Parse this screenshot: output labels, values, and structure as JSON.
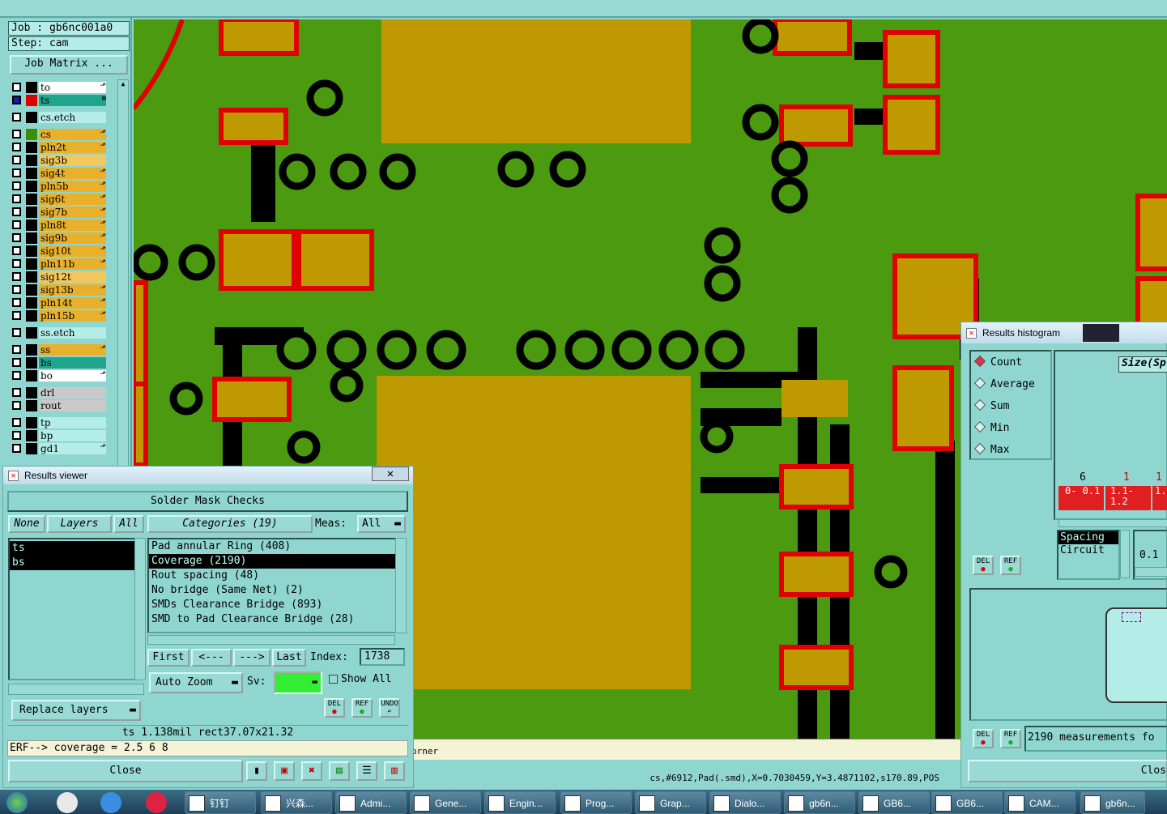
{
  "job": {
    "job_label": "Job : gb6nc001a0",
    "step_label": "Step: cam",
    "matrix_button": "Job Matrix ..."
  },
  "layers": [
    {
      "name": "to",
      "color": "#ffffff",
      "mark": "⬏"
    },
    {
      "name": "ts",
      "color": "#1fa58e",
      "mark": "⊞"
    },
    {
      "name": "cs.etch",
      "color": "#b4ece8",
      "mark": ""
    },
    {
      "name": "cs",
      "color": "#e9b12b",
      "mark": "⬏"
    },
    {
      "name": "pln2t",
      "color": "#e9b12b",
      "mark": "⬏"
    },
    {
      "name": "sig3b",
      "color": "#f2c75c",
      "mark": ""
    },
    {
      "name": "sig4t",
      "color": "#e9b12b",
      "mark": "⬏"
    },
    {
      "name": "pln5b",
      "color": "#e9b12b",
      "mark": "⬏"
    },
    {
      "name": "sig6t",
      "color": "#e9b12b",
      "mark": "⬏"
    },
    {
      "name": "sig7b",
      "color": "#e9b12b",
      "mark": "⬏"
    },
    {
      "name": "pln8t",
      "color": "#e9b12b",
      "mark": "⬏"
    },
    {
      "name": "sig9b",
      "color": "#e9b12b",
      "mark": "⬏"
    },
    {
      "name": "sig10t",
      "color": "#e9b12b",
      "mark": "⬏"
    },
    {
      "name": "pln11b",
      "color": "#e9b12b",
      "mark": "⬏"
    },
    {
      "name": "sig12t",
      "color": "#f2c75c",
      "mark": ""
    },
    {
      "name": "sig13b",
      "color": "#e9b12b",
      "mark": "⬏"
    },
    {
      "name": "pln14t",
      "color": "#e9b12b",
      "mark": "⬏"
    },
    {
      "name": "pln15b",
      "color": "#e9b12b",
      "mark": "⬏"
    },
    {
      "name": "ss.etch",
      "color": "#b4ece8",
      "mark": ""
    },
    {
      "name": "ss",
      "color": "#e9b12b",
      "mark": "⬏"
    },
    {
      "name": "bs",
      "color": "#1fa58e",
      "mark": ""
    },
    {
      "name": "bo",
      "color": "#ffffff",
      "mark": "⬏"
    },
    {
      "name": "drl",
      "color": "#c9c9c9",
      "mark": ""
    },
    {
      "name": "rout",
      "color": "#c9c9c9",
      "mark": ""
    },
    {
      "name": "tp",
      "color": "#b4ece8",
      "mark": ""
    },
    {
      "name": "bp",
      "color": "#b4ece8",
      "mark": ""
    },
    {
      "name": "gd1",
      "color": "#b4ece8",
      "mark": "⬏"
    }
  ],
  "results_viewer": {
    "window_title": "Results viewer",
    "close_x": "✕",
    "header": "Solder Mask Checks",
    "none_btn": "None",
    "layers_btn": "Layers",
    "all_btn": "All",
    "layer_items": [
      "ts",
      "bs"
    ],
    "categories_btn": "Categories (19)",
    "meas_label": "Meas:",
    "meas_value": "All",
    "categories": [
      "Pad annular Ring (408)",
      "Coverage (2190)",
      "Rout spacing (48)",
      "No bridge (Same Net) (2)",
      "SMDs Clearance Bridge (893)",
      "SMD to Pad Clearance Bridge (28)"
    ],
    "selected_category": 1,
    "first_btn": "First",
    "prev_btn": "<---",
    "next_btn": "--->",
    "last_btn": "Last",
    "index_label": "Index:",
    "index_value": "1738",
    "autozoom_btn": "Auto Zoom",
    "sv_label": "Sv:",
    "showall_label": "Show All",
    "replace_btn": "Replace layers",
    "del_label": "DEL",
    "ref_label": "REF",
    "undo_label": "UNDO",
    "info_line": "ts 1.138mil  rect37.07x21.32",
    "erf_line": "ERF--> coverage = 2.5 6 8",
    "close_btn": "Close"
  },
  "status": {
    "hint": "orner",
    "coords": "cs,#6912,Pad(.smd),X=0.7030459,Y=3.4871102,s170.89,POS"
  },
  "histogram": {
    "window_title": "Results histogram",
    "modes": [
      "Count",
      "Average",
      "Sum",
      "Min",
      "Max"
    ],
    "selected_mode": 0,
    "size_label": "Size(Sp",
    "bars": [
      {
        "count": "6",
        "range": "0- 0.1"
      },
      {
        "count": "1",
        "range": "1.1- 1.2"
      },
      {
        "count": "1",
        "range": "1."
      }
    ],
    "list_items": [
      "Spacing",
      "Circuit"
    ],
    "value_label": "0.1",
    "measurements": "2190 measurements fo",
    "close_btn": "Clos",
    "del_label": "DEL",
    "ref_label": "REF"
  },
  "taskbar": {
    "items": [
      "钉钉",
      "兴森...",
      "Admi...",
      "Gene...",
      "Engin...",
      "Prog...",
      "Grap...",
      "Dialo...",
      "gb6n...",
      "GB6...",
      "GB6...",
      "CAM...",
      "gb6n..."
    ]
  }
}
